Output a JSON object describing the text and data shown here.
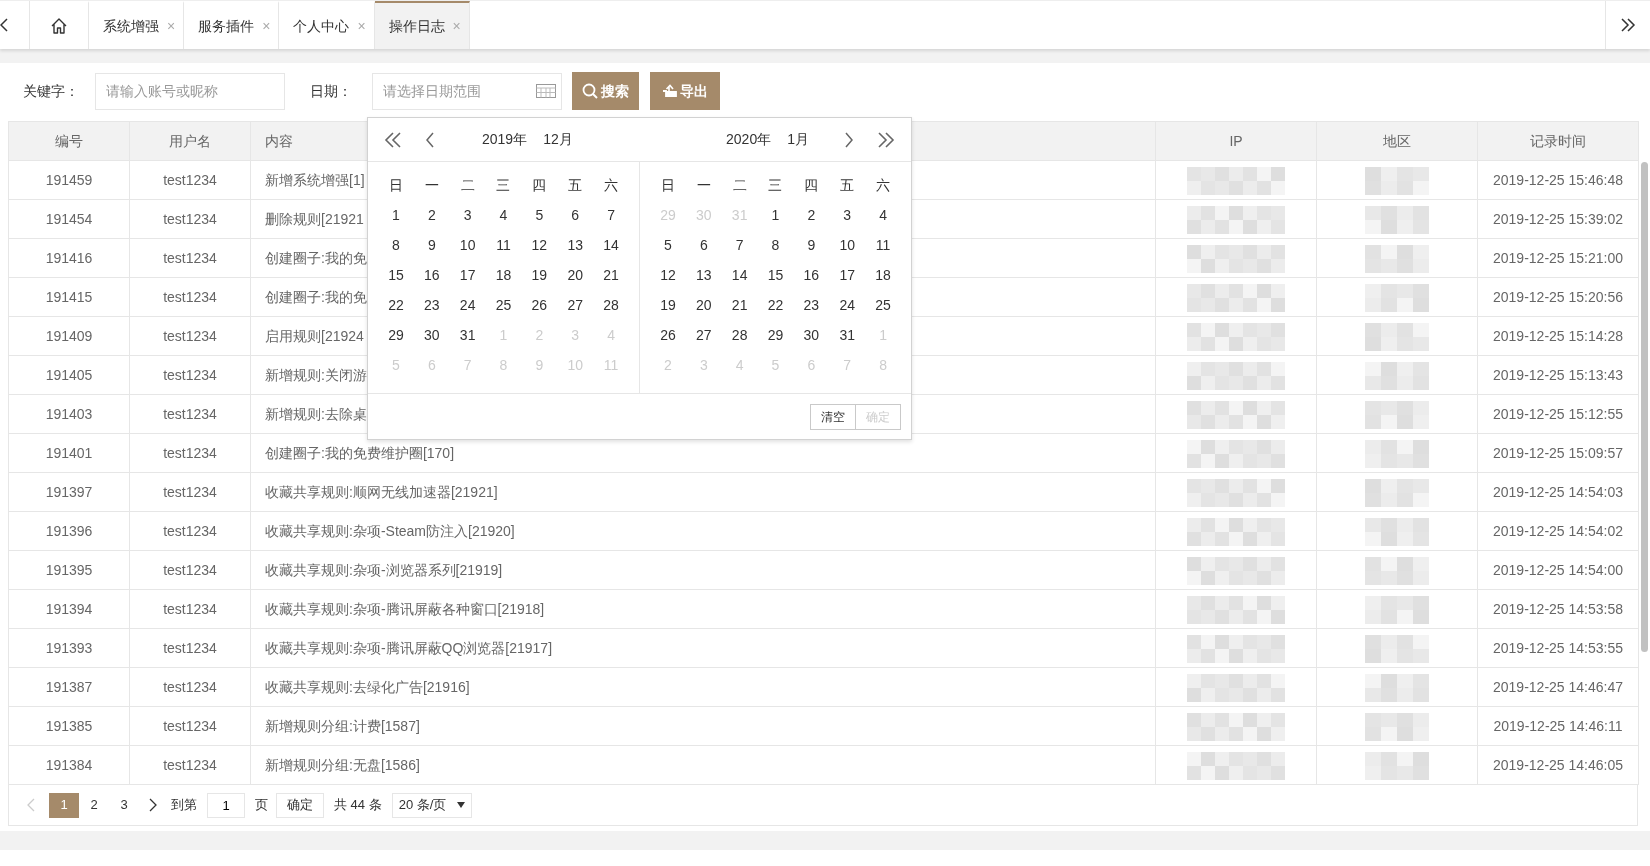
{
  "tabs": [
    {
      "kind": "home",
      "selected": false
    },
    {
      "kind": "page",
      "label": "系统增强",
      "close": "×",
      "selected": false
    },
    {
      "kind": "page",
      "label": "服务插件",
      "close": "×",
      "selected": false
    },
    {
      "kind": "page",
      "label": "个人中心",
      "close": "×",
      "selected": false
    },
    {
      "kind": "page",
      "label": "操作日志",
      "close": "×",
      "selected": true
    }
  ],
  "filters": {
    "keyword_label": "关键字：",
    "keyword_placeholder": "请输入账号或昵称",
    "date_label": "日期：",
    "date_placeholder": "请选择日期范围",
    "search_button": "搜索",
    "export_button": "导出"
  },
  "table": {
    "columns": [
      "编号",
      "用户名",
      "内容",
      "IP",
      "地区",
      "记录时间"
    ],
    "rows": [
      {
        "id": "191459",
        "user": "test1234",
        "content": "新增系统增强[1]",
        "time": "2019-12-25 15:46:48"
      },
      {
        "id": "191454",
        "user": "test1234",
        "content": "删除规则[21921",
        "time": "2019-12-25 15:39:02"
      },
      {
        "id": "191416",
        "user": "test1234",
        "content": "创建圈子:我的免",
        "time": "2019-12-25 15:21:00"
      },
      {
        "id": "191415",
        "user": "test1234",
        "content": "创建圈子:我的免",
        "time": "2019-12-25 15:20:56"
      },
      {
        "id": "191409",
        "user": "test1234",
        "content": "启用规则[21924",
        "time": "2019-12-25 15:14:28"
      },
      {
        "id": "191405",
        "user": "test1234",
        "content": "新增规则:关闭游",
        "time": "2019-12-25 15:13:43"
      },
      {
        "id": "191403",
        "user": "test1234",
        "content": "新增规则:去除桌",
        "time": "2019-12-25 15:12:55"
      },
      {
        "id": "191401",
        "user": "test1234",
        "content": "创建圈子:我的免费维护圈[170]",
        "time": "2019-12-25 15:09:57"
      },
      {
        "id": "191397",
        "user": "test1234",
        "content": "收藏共享规则:顺网无线加速器[21921]",
        "time": "2019-12-25 14:54:03"
      },
      {
        "id": "191396",
        "user": "test1234",
        "content": "收藏共享规则:杂项-Steam防注入[21920]",
        "time": "2019-12-25 14:54:02"
      },
      {
        "id": "191395",
        "user": "test1234",
        "content": "收藏共享规则:杂项-浏览器系列[21919]",
        "time": "2019-12-25 14:54:00"
      },
      {
        "id": "191394",
        "user": "test1234",
        "content": "收藏共享规则:杂项-腾讯屏蔽各种窗口[21918]",
        "time": "2019-12-25 14:53:58"
      },
      {
        "id": "191393",
        "user": "test1234",
        "content": "收藏共享规则:杂项-腾讯屏蔽QQ浏览器[21917]",
        "time": "2019-12-25 14:53:55"
      },
      {
        "id": "191387",
        "user": "test1234",
        "content": "收藏共享规则:去绿化广告[21916]",
        "time": "2019-12-25 14:46:47"
      },
      {
        "id": "191385",
        "user": "test1234",
        "content": "新增规则分组:计费[1587]",
        "time": "2019-12-25 14:46:11"
      },
      {
        "id": "191384",
        "user": "test1234",
        "content": "新增规则分组:无盘[1586]",
        "time": "2019-12-25 14:46:05"
      }
    ]
  },
  "calendar": {
    "months": [
      {
        "year": "2019年",
        "month": "12月",
        "weekdays": [
          "日",
          "一",
          "二",
          "三",
          "四",
          "五",
          "六"
        ],
        "weeks": [
          [
            {
              "day": "1",
              "muted": false
            },
            {
              "day": "2",
              "muted": false
            },
            {
              "day": "3",
              "muted": false
            },
            {
              "day": "4",
              "muted": false
            },
            {
              "day": "5",
              "muted": false
            },
            {
              "day": "6",
              "muted": false
            },
            {
              "day": "7",
              "muted": false
            }
          ],
          [
            {
              "day": "8",
              "muted": false
            },
            {
              "day": "9",
              "muted": false
            },
            {
              "day": "10",
              "muted": false
            },
            {
              "day": "11",
              "muted": false
            },
            {
              "day": "12",
              "muted": false
            },
            {
              "day": "13",
              "muted": false
            },
            {
              "day": "14",
              "muted": false
            }
          ],
          [
            {
              "day": "15",
              "muted": false
            },
            {
              "day": "16",
              "muted": false
            },
            {
              "day": "17",
              "muted": false
            },
            {
              "day": "18",
              "muted": false
            },
            {
              "day": "19",
              "muted": false
            },
            {
              "day": "20",
              "muted": false
            },
            {
              "day": "21",
              "muted": false
            }
          ],
          [
            {
              "day": "22",
              "muted": false
            },
            {
              "day": "23",
              "muted": false
            },
            {
              "day": "24",
              "muted": false
            },
            {
              "day": "25",
              "muted": false
            },
            {
              "day": "26",
              "muted": false
            },
            {
              "day": "27",
              "muted": false
            },
            {
              "day": "28",
              "muted": false
            }
          ],
          [
            {
              "day": "29",
              "muted": false
            },
            {
              "day": "30",
              "muted": false
            },
            {
              "day": "31",
              "muted": false
            },
            {
              "day": "1",
              "muted": true
            },
            {
              "day": "2",
              "muted": true
            },
            {
              "day": "3",
              "muted": true
            },
            {
              "day": "4",
              "muted": true
            }
          ],
          [
            {
              "day": "5",
              "muted": true
            },
            {
              "day": "6",
              "muted": true
            },
            {
              "day": "7",
              "muted": true
            },
            {
              "day": "8",
              "muted": true
            },
            {
              "day": "9",
              "muted": true
            },
            {
              "day": "10",
              "muted": true
            },
            {
              "day": "11",
              "muted": true
            }
          ]
        ]
      },
      {
        "year": "2020年",
        "month": "1月",
        "weekdays": [
          "日",
          "一",
          "二",
          "三",
          "四",
          "五",
          "六"
        ],
        "weeks": [
          [
            {
              "day": "29",
              "muted": true
            },
            {
              "day": "30",
              "muted": true
            },
            {
              "day": "31",
              "muted": true
            },
            {
              "day": "1",
              "muted": false
            },
            {
              "day": "2",
              "muted": false
            },
            {
              "day": "3",
              "muted": false
            },
            {
              "day": "4",
              "muted": false
            }
          ],
          [
            {
              "day": "5",
              "muted": false
            },
            {
              "day": "6",
              "muted": false
            },
            {
              "day": "7",
              "muted": false
            },
            {
              "day": "8",
              "muted": false
            },
            {
              "day": "9",
              "muted": false
            },
            {
              "day": "10",
              "muted": false
            },
            {
              "day": "11",
              "muted": false
            }
          ],
          [
            {
              "day": "12",
              "muted": false
            },
            {
              "day": "13",
              "muted": false
            },
            {
              "day": "14",
              "muted": false
            },
            {
              "day": "15",
              "muted": false
            },
            {
              "day": "16",
              "muted": false
            },
            {
              "day": "17",
              "muted": false
            },
            {
              "day": "18",
              "muted": false
            }
          ],
          [
            {
              "day": "19",
              "muted": false
            },
            {
              "day": "20",
              "muted": false
            },
            {
              "day": "21",
              "muted": false
            },
            {
              "day": "22",
              "muted": false
            },
            {
              "day": "23",
              "muted": false
            },
            {
              "day": "24",
              "muted": false
            },
            {
              "day": "25",
              "muted": false
            }
          ],
          [
            {
              "day": "26",
              "muted": false
            },
            {
              "day": "27",
              "muted": false
            },
            {
              "day": "28",
              "muted": false
            },
            {
              "day": "29",
              "muted": false
            },
            {
              "day": "30",
              "muted": false
            },
            {
              "day": "31",
              "muted": false
            },
            {
              "day": "1",
              "muted": true
            }
          ],
          [
            {
              "day": "2",
              "muted": true
            },
            {
              "day": "3",
              "muted": true
            },
            {
              "day": "4",
              "muted": true
            },
            {
              "day": "5",
              "muted": true
            },
            {
              "day": "6",
              "muted": true
            },
            {
              "day": "7",
              "muted": true
            },
            {
              "day": "8",
              "muted": true
            }
          ]
        ]
      }
    ],
    "buttons": [
      {
        "label": "清空",
        "disabled": false
      },
      {
        "label": "确定",
        "disabled": true
      }
    ]
  },
  "pagination": {
    "pages": [
      {
        "label": "1",
        "selected": true
      },
      {
        "label": "2",
        "selected": false
      },
      {
        "label": "3",
        "selected": false
      }
    ],
    "prev_disabled": true,
    "goto_label": "到第",
    "goto_value": "1",
    "page_label": "页",
    "confirm": "确定",
    "total": "共 44 条",
    "page_size": "20 条/页"
  }
}
